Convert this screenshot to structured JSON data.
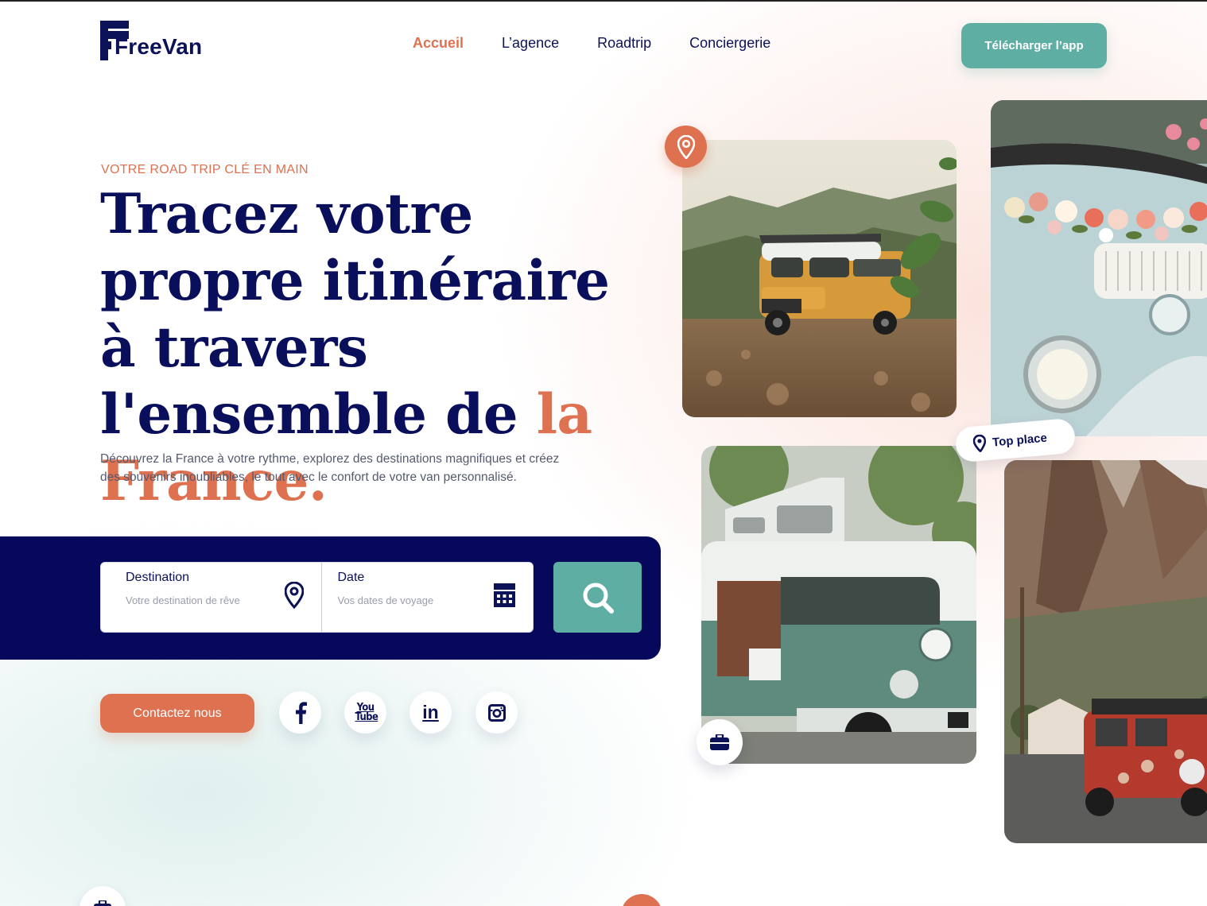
{
  "brand": {
    "name": "FreeVan"
  },
  "nav": {
    "items": [
      {
        "label": "Accueil",
        "active": true
      },
      {
        "label": "L’agence",
        "active": false
      },
      {
        "label": "Roadtrip",
        "active": false
      },
      {
        "label": "Conciergerie",
        "active": false
      }
    ]
  },
  "header": {
    "cta_label": "Télécharger l’app"
  },
  "hero": {
    "eyebrow": "VOTRE ROAD TRIP CLÉ EN MAIN",
    "title_main": "Tracez votre propre itinéraire à travers l'ensemble de ",
    "title_accent": "la France.",
    "description": "Découvrez la France à votre rythme, explorez des destinations magnifiques et créez des souvenirs inoubliables, le tout avec le confort de votre van personnalisé."
  },
  "search": {
    "destination": {
      "label": "Destination",
      "placeholder": "Votre destination de rêve",
      "value": ""
    },
    "date": {
      "label": "Date",
      "placeholder": "Vos dates de voyage",
      "value": ""
    }
  },
  "contact": {
    "label": "Contactez nous"
  },
  "social": [
    {
      "icon": "facebook-icon"
    },
    {
      "icon": "youtube-icon",
      "text": "You Tube"
    },
    {
      "icon": "linkedin-icon",
      "text": "in"
    },
    {
      "icon": "instagram-icon"
    }
  ],
  "gallery": {
    "badge_label": "Top place"
  },
  "colors": {
    "navy": "#0b1257",
    "band": "#06085c",
    "accent": "#dd7150",
    "teal": "#5eaea4"
  }
}
